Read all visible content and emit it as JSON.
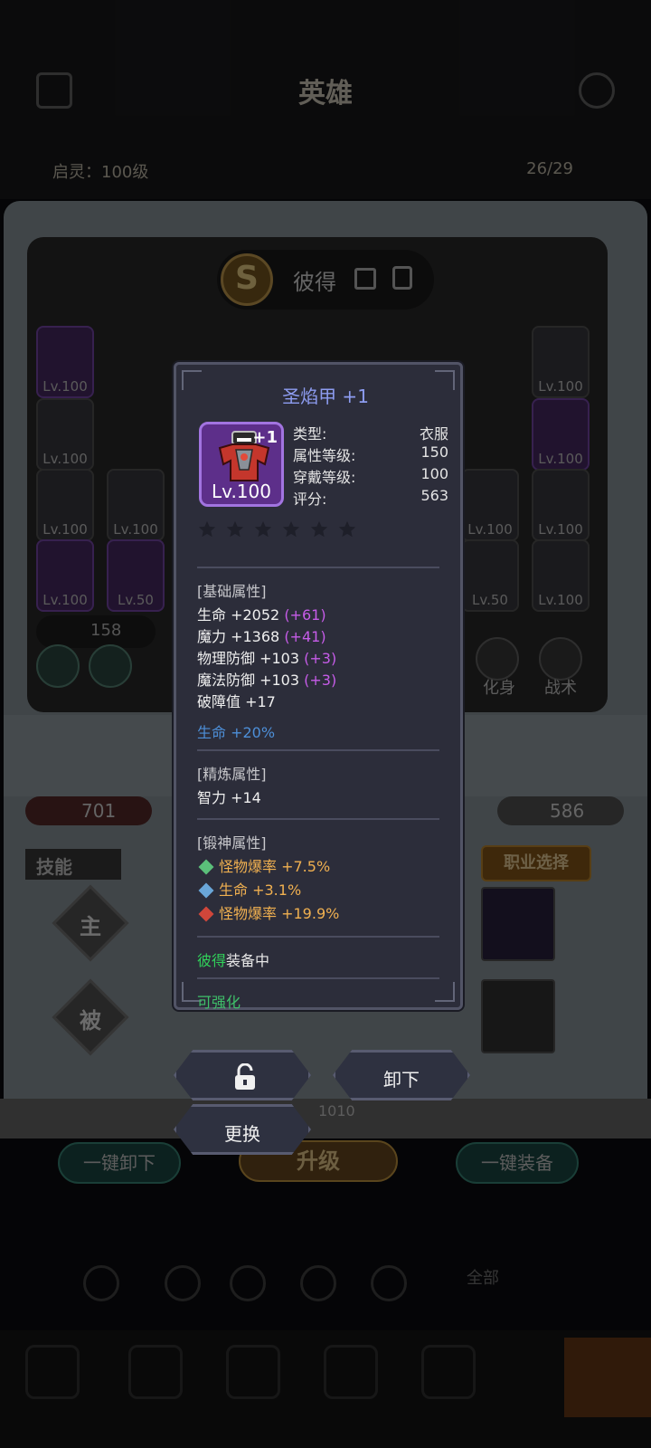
{
  "background": {
    "title": "英雄",
    "hero_level": "启灵：100级",
    "hero_count": "26/29",
    "hero_grade": "S",
    "hero_name": "彼得",
    "slots_left": [
      "Lv.100",
      "Lv.100",
      "Lv.100",
      "Lv.100",
      "Lv.100",
      "Lv.50"
    ],
    "slots_right": [
      "Lv.100",
      "Lv.100",
      "Lv.100",
      "Lv.100",
      "Lv.50",
      "Lv.100"
    ],
    "power": "158",
    "btn_avatar": "化身",
    "btn_tactics": "战术",
    "attack_power": "701",
    "defense_power": "586",
    "skills_tab": "技能",
    "job_select": "职业选择",
    "active_skill": "主",
    "passive_skill": "被",
    "ribbon_number": "1010",
    "unequip_all": "一键卸下",
    "upgrade": "升级",
    "equip_all": "一键装备",
    "filter_all": "全部",
    "filter_all_icon": "ALL"
  },
  "popup": {
    "title": "圣焰甲 +1",
    "item_level": "Lv.100",
    "item_plus": "+1",
    "info": [
      {
        "key": "类型:",
        "value": "衣服"
      },
      {
        "key": "属性等级:",
        "value": "150"
      },
      {
        "key": "穿戴等级:",
        "value": "100"
      },
      {
        "key": "评分:",
        "value": "563"
      }
    ],
    "stars_total": 6,
    "stars_filled": 0,
    "base_header": "[基础属性]",
    "base_stats": [
      {
        "text": "生命 +2052",
        "bonus": "(+61)"
      },
      {
        "text": "魔力 +1368",
        "bonus": "(+41)"
      },
      {
        "text": "物理防御 +103",
        "bonus": "(+3)"
      },
      {
        "text": "魔法防御 +103",
        "bonus": "(+3)"
      },
      {
        "text": "破障值 +17",
        "bonus": ""
      }
    ],
    "extra_stat": "生命 +20%",
    "refine_header": "[精炼属性]",
    "refine_stat": "智力 +14",
    "forge_header": "[锻神属性]",
    "forge_stats": [
      {
        "text": "怪物爆率 +7.5%",
        "gem_color": "#5bbf7a"
      },
      {
        "text": "生命 +3.1%",
        "gem_color": "#6aa6d8"
      },
      {
        "text": "怪物爆率 +19.9%",
        "gem_color": "#d0463a"
      }
    ],
    "equipped_owner": "彼得",
    "equipped_suffix": "装备中",
    "upgradable": "可强化",
    "btn_unequip": "卸下",
    "btn_replace": "更换"
  }
}
